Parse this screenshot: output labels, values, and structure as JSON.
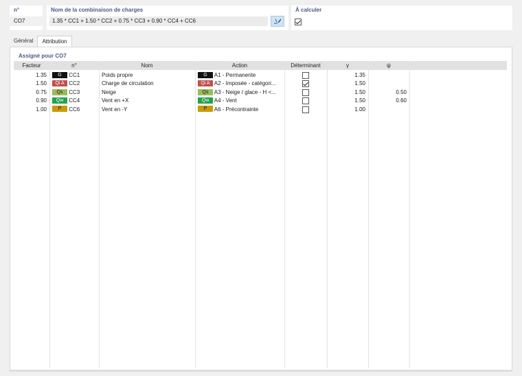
{
  "header": {
    "no_label": "n°",
    "no_value": "CO7",
    "name_label": "Nom de la combinaison de charges",
    "name_value": "1.35 * CC1 + 1.50 * CC2 + 0.75 * CC3 + 0.90 * CC4 + CC6",
    "calc_label": "À calculer",
    "calc_checked": true
  },
  "tabs": [
    {
      "label": "Général",
      "active": false
    },
    {
      "label": "Attribution",
      "active": true
    }
  ],
  "panel_title": "Assigné pour CO7",
  "table": {
    "columns": [
      "Facteur",
      "n°",
      "Nom",
      "Action",
      "Déterminant",
      "γ",
      "ψ"
    ],
    "rows": [
      {
        "factor": "1.35",
        "badge": "G",
        "badge_color": "#111111",
        "badge_text_color": "#ffffff",
        "no": "CC1",
        "name": "Poids propre",
        "action_badge": "G",
        "action": "A1 - Permanente",
        "determinant": false,
        "gamma": "1.35",
        "psi": ""
      },
      {
        "factor": "1.50",
        "badge": "Qi A",
        "badge_color": "#c0504d",
        "badge_text_color": "#ffffff",
        "no": "CC2",
        "name": "Charge de circulation",
        "action_badge": "Qi A",
        "action": "A2 - Imposée - catégori...",
        "determinant": true,
        "gamma": "1.50",
        "psi": ""
      },
      {
        "factor": "0.75",
        "badge": "Qs",
        "badge_color": "#9bbb59",
        "badge_text_color": "#1a1a1a",
        "no": "CC3",
        "name": "Neige",
        "action_badge": "Qs",
        "action": "A3 - Neige / glace - H <...",
        "determinant": false,
        "gamma": "1.50",
        "psi": "0.50"
      },
      {
        "factor": "0.90",
        "badge": "Qw",
        "badge_color": "#21a24c",
        "badge_text_color": "#ffffff",
        "no": "CC4",
        "name": "Vent en +X",
        "action_badge": "Qw",
        "action": "A4 - Vent",
        "determinant": false,
        "gamma": "1.50",
        "psi": "0.60"
      },
      {
        "factor": "1.00",
        "badge": "P",
        "badge_color": "#c69b0a",
        "badge_text_color": "#1a1a1a",
        "no": "CC6",
        "name": "Vent en -Y",
        "action_badge": "P",
        "action": "A6 - Précontrainte",
        "determinant": false,
        "gamma": "1.00",
        "psi": ""
      }
    ]
  },
  "icons": {
    "edit": "edit-formula-icon"
  }
}
